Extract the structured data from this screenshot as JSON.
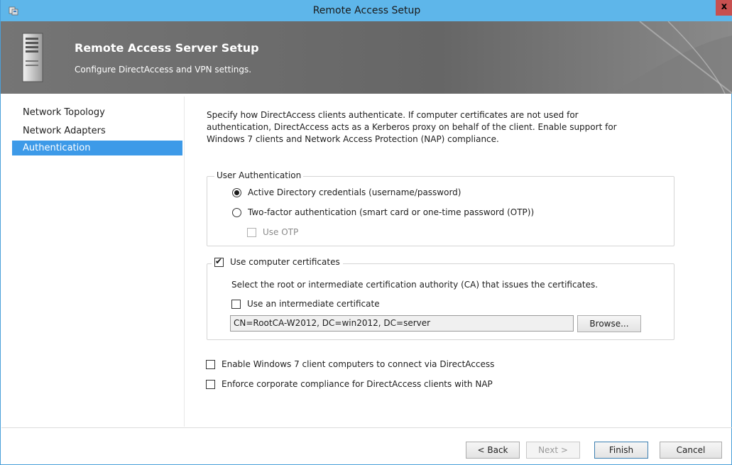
{
  "window": {
    "title": "Remote Access Setup",
    "close_label": "x"
  },
  "header": {
    "title": "Remote Access Server Setup",
    "subtitle": "Configure DirectAccess and VPN settings."
  },
  "nav": {
    "items": [
      {
        "label": "Network Topology",
        "selected": false
      },
      {
        "label": "Network Adapters",
        "selected": false
      },
      {
        "label": "Authentication",
        "selected": true
      }
    ]
  },
  "content": {
    "description": "Specify how DirectAccess clients authenticate. If computer certificates are not used for authentication, DirectAccess acts as a Kerberos proxy on behalf of the client. Enable support for Windows 7 clients and Network Access Protection (NAP) compliance.",
    "user_auth": {
      "legend": "User Authentication",
      "option_ad": "Active Directory credentials (username/password)",
      "option_two_factor": "Two-factor authentication (smart card or one-time password (OTP))",
      "use_otp": "Use OTP",
      "selected": "ad"
    },
    "certs": {
      "legend": "Use computer certificates",
      "checked": true,
      "instruction": "Select the root or intermediate certification authority (CA) that issues the certificates.",
      "intermediate_label": "Use an intermediate certificate",
      "ca_value": "CN=RootCA-W2012, DC=win2012, DC=server",
      "browse_label": "Browse..."
    },
    "win7_label": "Enable Windows 7 client computers to connect via DirectAccess",
    "nap_label": "Enforce corporate compliance for DirectAccess clients with NAP"
  },
  "footer": {
    "back": "< Back",
    "next": "Next >",
    "finish": "Finish",
    "cancel": "Cancel"
  },
  "colors": {
    "titlebar": "#5eb6ea",
    "header_bg": "#6b6b6b",
    "selection": "#3d9ae8",
    "close": "#c75050"
  }
}
